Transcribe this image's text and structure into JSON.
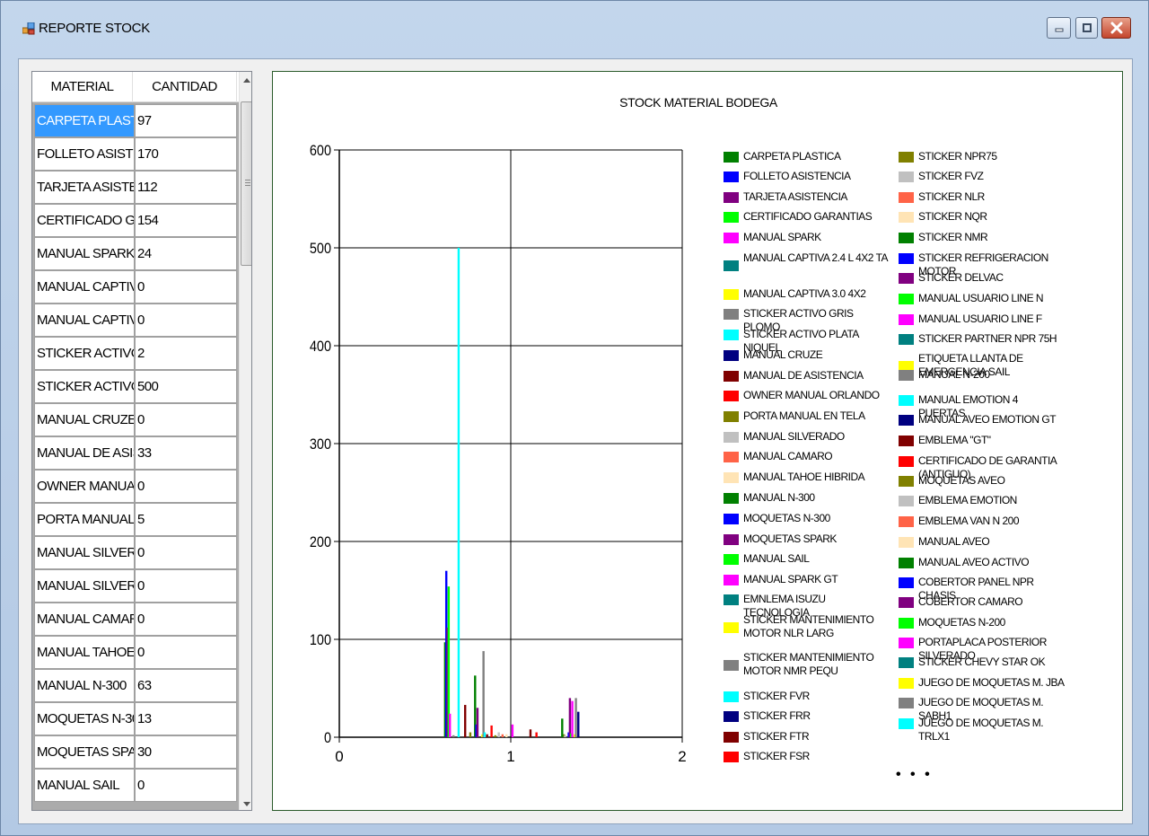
{
  "window": {
    "title": "REPORTE STOCK",
    "icon": "app-window-icon",
    "buttons": {
      "minimize": "minimize-icon",
      "maximize": "maximize-icon",
      "close": "close-icon"
    }
  },
  "grid": {
    "columns": [
      "MATERIAL",
      "CANTIDAD"
    ],
    "selected_index": 0,
    "rows": [
      {
        "material": "CARPETA PLASTICA",
        "cantidad": "97"
      },
      {
        "material": "FOLLETO ASISTEN...",
        "cantidad": "170"
      },
      {
        "material": "TARJETA  ASISTE...",
        "cantidad": "112"
      },
      {
        "material": "CERTIFICADO GAR...",
        "cantidad": "154"
      },
      {
        "material": "MANUAL SPARK",
        "cantidad": "24"
      },
      {
        "material": "MANUAL CAPTIVA ...",
        "cantidad": "0"
      },
      {
        "material": "MANUAL CAPTIVA ...",
        "cantidad": "0"
      },
      {
        "material": "STICKER ACTIVO ...",
        "cantidad": "2"
      },
      {
        "material": "STICKER ACTIVO P...",
        "cantidad": "500"
      },
      {
        "material": "MANUAL CRUZE",
        "cantidad": "0"
      },
      {
        "material": "MANUAL DE ASIST...",
        "cantidad": "33"
      },
      {
        "material": "OWNER MANUAL ...",
        "cantidad": "0"
      },
      {
        "material": "PORTA MANUAL E...",
        "cantidad": "5"
      },
      {
        "material": "MANUAL SILVERA...",
        "cantidad": "0"
      },
      {
        "material": "MANUAL SILVERA...",
        "cantidad": "0"
      },
      {
        "material": "MANUAL CAMARO",
        "cantidad": "0"
      },
      {
        "material": "MANUAL TAHOE H...",
        "cantidad": "0"
      },
      {
        "material": "MANUAL N-300",
        "cantidad": "63"
      },
      {
        "material": "MOQUETAS N-300",
        "cantidad": "13"
      },
      {
        "material": "MOQUETAS SPARK",
        "cantidad": "30"
      },
      {
        "material": "MANUAL SAIL",
        "cantidad": "0"
      }
    ],
    "scrollbar": {
      "up": "scroll-up-icon",
      "down": "scroll-down-icon"
    }
  },
  "chart_data": {
    "type": "bar",
    "title": "STOCK MATERIAL BODEGA",
    "xlabel": "",
    "ylabel": "",
    "xlim": [
      0,
      2
    ],
    "ylim": [
      0,
      600
    ],
    "x_ticks": [
      "0",
      "1",
      "2"
    ],
    "y_ticks": [
      "0",
      "100",
      "200",
      "300",
      "400",
      "500",
      "600"
    ],
    "grid": true,
    "legend_position": "right",
    "legend_overflow": "• • •",
    "series": [
      {
        "name": "CARPETA PLASTICA",
        "color": "#008000",
        "x": 0.617,
        "value": 97
      },
      {
        "name": "FOLLETO ASISTENCIA",
        "color": "#0000ff",
        "x": 0.624,
        "value": 170
      },
      {
        "name": "TARJETA  ASISTENCIA",
        "color": "#800080",
        "x": 0.631,
        "value": 112
      },
      {
        "name": "CERTIFICADO GARANTIAS",
        "color": "#00ff00",
        "x": 0.638,
        "value": 154
      },
      {
        "name": "MANUAL SPARK",
        "color": "#ff00ff",
        "x": 0.645,
        "value": 24
      },
      {
        "name": "MANUAL CAPTIVA 2.4 L 4X2 TA",
        "color": "#008080",
        "x": 0.652,
        "value": 0
      },
      {
        "name": "MANUAL CAPTIVA 3.0  4X2",
        "color": "#ffff00",
        "x": 0.659,
        "value": 0
      },
      {
        "name": "STICKER ACTIVO GRIS PLOMO",
        "color": "#808080",
        "x": 0.666,
        "value": 2
      },
      {
        "name": "STICKER ACTIVO PLATA NIQUEL",
        "color": "#00ffff",
        "x": 0.696,
        "value": 500
      },
      {
        "name": "MANUAL CRUZE",
        "color": "#000080",
        "x": 0.703,
        "value": 0
      },
      {
        "name": "MANUAL DE ASISTENCIA",
        "color": "#800000",
        "x": 0.734,
        "value": 33
      },
      {
        "name": "OWNER MANUAL ORLANDO",
        "color": "#ff0000",
        "x": 0.741,
        "value": 0
      },
      {
        "name": "PORTA MANUAL EN TELA",
        "color": "#808000",
        "x": 0.764,
        "value": 5
      },
      {
        "name": "MANUAL SILVERADO",
        "color": "#c0c0c0",
        "x": 0.771,
        "value": 0
      },
      {
        "name": "MANUAL CAMARO",
        "color": "#ff6347",
        "x": 0.778,
        "value": 0
      },
      {
        "name": "MANUAL TAHOE HIBRIDA",
        "color": "#ffe4b5",
        "x": 0.785,
        "value": 0
      },
      {
        "name": "MANUAL N-300",
        "color": "#008000",
        "x": 0.792,
        "value": 63
      },
      {
        "name": "MOQUETAS N-300",
        "color": "#0000ff",
        "x": 0.799,
        "value": 13
      },
      {
        "name": "MOQUETAS SPARK",
        "color": "#800080",
        "x": 0.806,
        "value": 30
      },
      {
        "name": "MANUAL SAIL",
        "color": "#00ff00",
        "x": 0.813,
        "value": 0
      },
      {
        "name": "MANUAL SPARK GT",
        "color": "#ff00ff",
        "x": 0.82,
        "value": 0
      },
      {
        "name": "EMNLEMA ISUZU TECNOLOGIA",
        "color": "#008080",
        "x": 0.827,
        "value": 0
      },
      {
        "name": "STICKER MANTENIMIENTO MOTOR NLR LARG",
        "color": "#ffff00",
        "x": 0.834,
        "value": 3
      },
      {
        "name": "STICKER MANTENIMIENTO MOTOR NMR PEQU",
        "color": "#808080",
        "x": 0.841,
        "value": 88
      },
      {
        "name": "STICKER FVR",
        "color": "#00ffff",
        "x": 0.848,
        "value": 5
      },
      {
        "name": "STICKER FRR",
        "color": "#000080",
        "x": 0.855,
        "value": 0
      },
      {
        "name": "STICKER FTR",
        "color": "#800000",
        "x": 0.862,
        "value": 3
      },
      {
        "name": "STICKER FSR",
        "color": "#ff0000",
        "x": 0.888,
        "value": 12
      },
      {
        "name": "STICKER NPR75",
        "color": "#808000",
        "x": 0.91,
        "value": 2
      },
      {
        "name": "STICKER FVZ",
        "color": "#c0c0c0",
        "x": 0.93,
        "value": 5
      },
      {
        "name": "STICKER NLR",
        "color": "#ff6347",
        "x": 0.952,
        "value": 3
      },
      {
        "name": "STICKER NQR",
        "color": "#ffe4b5",
        "x": 0.975,
        "value": 3
      },
      {
        "name": "STICKER NMR",
        "color": "#008000",
        "x": 0.982,
        "value": 0
      },
      {
        "name": "STICKER REFRIGERACION MOTOR",
        "color": "#0000ff",
        "x": 0.989,
        "value": 0
      },
      {
        "name": "STICKER DELVAC",
        "color": "#800080",
        "x": 0.996,
        "value": 0
      },
      {
        "name": "MANUAL USUARIO LINE N",
        "color": "#00ff00",
        "x": 1.003,
        "value": 0
      },
      {
        "name": "MANUAL USUARIO LINE F",
        "color": "#ff00ff",
        "x": 1.01,
        "value": 13
      },
      {
        "name": "STICKER PARTNER NPR 75H",
        "color": "#008080",
        "x": 1.017,
        "value": 0
      },
      {
        "name": "ETIQUETA LLANTA DE EMERGENCIA SAIL",
        "color": "#ffff00",
        "x": 1.024,
        "value": 0
      },
      {
        "name": "MANUAL N-200",
        "color": "#808080",
        "x": 1.031,
        "value": 0
      },
      {
        "name": "MANUAL EMOTION 4 PUERTAS",
        "color": "#00ffff",
        "x": 1.038,
        "value": 0
      },
      {
        "name": "MANUAL  AVEO EMOTION GT",
        "color": "#000080",
        "x": 1.045,
        "value": 0
      },
      {
        "name": "EMBLEMA \"GT\"",
        "color": "#800000",
        "x": 1.115,
        "value": 8
      },
      {
        "name": "CERTIFICADO DE GARANTIA (ANTIGUO)",
        "color": "#ff0000",
        "x": 1.15,
        "value": 5
      },
      {
        "name": "MOQUETAS  AVEO",
        "color": "#808000",
        "x": 1.31,
        "value": 3
      },
      {
        "name": "EMBLEMA EMOTION",
        "color": "#c0c0c0",
        "x": 1.317,
        "value": 2
      },
      {
        "name": "EMBLEMA VAN N 200",
        "color": "#ff6347",
        "x": 1.324,
        "value": 0
      },
      {
        "name": "MANUAL AVEO",
        "color": "#ffe4b5",
        "x": 1.331,
        "value": 0
      },
      {
        "name": "MANUAL AVEO ACTIVO",
        "color": "#008000",
        "x": 1.3,
        "value": 19
      },
      {
        "name": "COBERTOR PANEL NPR  CHASIS",
        "color": "#0000ff",
        "x": 1.338,
        "value": 5
      },
      {
        "name": "COBERTOR CAMARO",
        "color": "#800080",
        "x": 1.345,
        "value": 40
      },
      {
        "name": "MOQUETAS  N-200",
        "color": "#00ff00",
        "x": 1.352,
        "value": 4
      },
      {
        "name": "PORTAPLACA POSTERIOR SILVERADO",
        "color": "#ff00ff",
        "x": 1.359,
        "value": 37
      },
      {
        "name": "STICKER CHEVY STAR OK",
        "color": "#008080",
        "x": 1.366,
        "value": 0
      },
      {
        "name": "JUEGO DE MOQUETAS M. JBA",
        "color": "#ffff00",
        "x": 1.373,
        "value": 3
      },
      {
        "name": "JUEGO DE MOQUETAS M. SABH1",
        "color": "#808080",
        "x": 1.38,
        "value": 40
      },
      {
        "name": "JUEGO DE MOQUETAS M. TRLX1",
        "color": "#00ffff",
        "x": 1.387,
        "value": 0
      },
      {
        "name": "",
        "color": "#000080",
        "x": 1.394,
        "value": 26
      }
    ]
  }
}
